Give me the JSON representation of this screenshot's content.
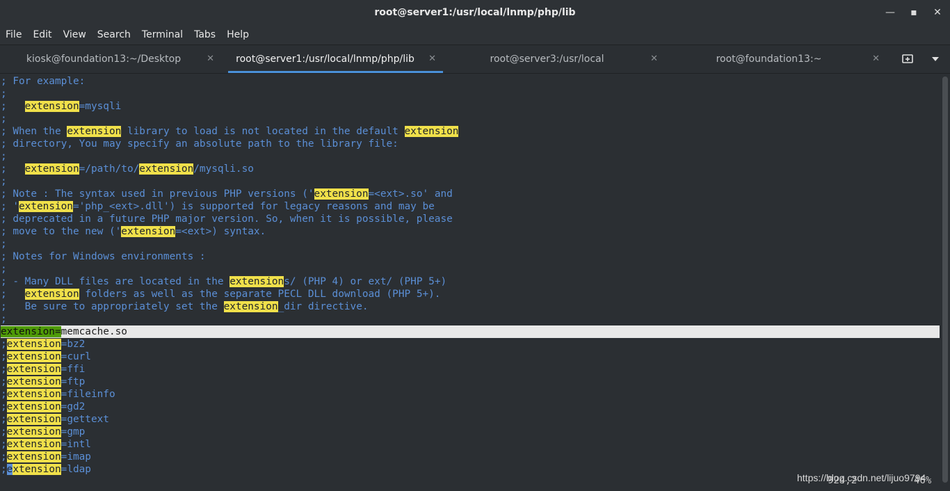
{
  "window": {
    "title": "root@server1:/usr/local/lnmp/php/lib",
    "minimize_glyph": "—",
    "maximize_glyph": "▪",
    "close_glyph": "✕"
  },
  "menu": [
    "File",
    "Edit",
    "View",
    "Search",
    "Terminal",
    "Tabs",
    "Help"
  ],
  "tabs": [
    {
      "label": "kiosk@foundation13:~/Desktop",
      "active": false
    },
    {
      "label": "root@server1:/usr/local/lnmp/php/lib",
      "active": true
    },
    {
      "label": "root@server3:/usr/local",
      "active": false
    },
    {
      "label": "root@foundation13:~",
      "active": false
    }
  ],
  "tab_close_glyph": "✕",
  "colors": {
    "accent": "#4a90d9",
    "comment": "#5b8fd6",
    "search_highlight": "#f0e04a",
    "current_match": "#4e9a06"
  },
  "lines": [
    [
      {
        "t": "; For example:"
      }
    ],
    [
      {
        "t": ";"
      }
    ],
    [
      {
        "t": ";   "
      },
      {
        "t": "extension",
        "h": 1
      },
      {
        "t": "=mysqli"
      }
    ],
    [
      {
        "t": ";"
      }
    ],
    [
      {
        "t": "; When the "
      },
      {
        "t": "extension",
        "h": 1
      },
      {
        "t": " library to load is not located in the default "
      },
      {
        "t": "extension",
        "h": 1
      }
    ],
    [
      {
        "t": "; directory, You may specify an absolute path to the library file:"
      }
    ],
    [
      {
        "t": ";"
      }
    ],
    [
      {
        "t": ";   "
      },
      {
        "t": "extension",
        "h": 1
      },
      {
        "t": "=/path/to/"
      },
      {
        "t": "extension",
        "h": 1
      },
      {
        "t": "/mysqli.so"
      }
    ],
    [
      {
        "t": ";"
      }
    ],
    [
      {
        "t": "; Note : The syntax used in previous PHP versions ('"
      },
      {
        "t": "extension",
        "h": 1
      },
      {
        "t": "=<ext>.so' and"
      }
    ],
    [
      {
        "t": "; '"
      },
      {
        "t": "extension",
        "h": 1
      },
      {
        "t": "='php_<ext>.dll') is supported for legacy reasons and may be"
      }
    ],
    [
      {
        "t": "; deprecated in a future PHP major version. So, when it is possible, please"
      }
    ],
    [
      {
        "t": "; move to the new ('"
      },
      {
        "t": "extension",
        "h": 1
      },
      {
        "t": "=<ext>) syntax."
      }
    ],
    [
      {
        "t": ";"
      }
    ],
    [
      {
        "t": "; Notes for Windows environments :"
      }
    ],
    [
      {
        "t": ";"
      }
    ],
    [
      {
        "t": "; - Many DLL files are located in the "
      },
      {
        "t": "extension",
        "h": 1
      },
      {
        "t": "s/ (PHP 4) or ext/ (PHP 5+)"
      }
    ],
    [
      {
        "t": ";   "
      },
      {
        "t": "extension",
        "h": 1
      },
      {
        "t": " folders as well as the separate PECL DLL download (PHP 5+)."
      }
    ],
    [
      {
        "t": ";   Be sure to appropriately set the "
      },
      {
        "t": "extension",
        "h": 1
      },
      {
        "t": "_dir directive."
      }
    ],
    [
      {
        "t": ";"
      }
    ],
    [
      {
        "t": "extension=",
        "h": 1
      },
      {
        "t": "memcache.so"
      }
    ],
    [
      {
        "t": ";"
      },
      {
        "t": "extension",
        "h": 1
      },
      {
        "t": "=bz2"
      }
    ],
    [
      {
        "t": ";"
      },
      {
        "t": "extension",
        "h": 1
      },
      {
        "t": "=curl"
      }
    ],
    [
      {
        "t": ";"
      },
      {
        "t": "extension",
        "h": 1
      },
      {
        "t": "=ffi"
      }
    ],
    [
      {
        "t": ";"
      },
      {
        "t": "extension",
        "h": 1
      },
      {
        "t": "=ftp"
      }
    ],
    [
      {
        "t": ";"
      },
      {
        "t": "extension",
        "h": 1
      },
      {
        "t": "=fileinfo"
      }
    ],
    [
      {
        "t": ";"
      },
      {
        "t": "extension",
        "h": 1
      },
      {
        "t": "=gd2"
      }
    ],
    [
      {
        "t": ";"
      },
      {
        "t": "extension",
        "h": 1
      },
      {
        "t": "=gettext"
      }
    ],
    [
      {
        "t": ";"
      },
      {
        "t": "extension",
        "h": 1
      },
      {
        "t": "=gmp"
      }
    ],
    [
      {
        "t": ";"
      },
      {
        "t": "extension",
        "h": 1
      },
      {
        "t": "=intl"
      }
    ],
    [
      {
        "t": ";"
      },
      {
        "t": "extension",
        "h": 1
      },
      {
        "t": "=imap"
      }
    ],
    [
      {
        "t": ";"
      },
      {
        "t": "e",
        "c": 1
      },
      {
        "t": "xtension",
        "h": 1
      },
      {
        "t": "=ldap"
      }
    ]
  ],
  "active_line_index": 20,
  "status": {
    "position": "924,2",
    "percent": "46%"
  },
  "watermark": "https://blog.csdn.net/lijuo9794"
}
